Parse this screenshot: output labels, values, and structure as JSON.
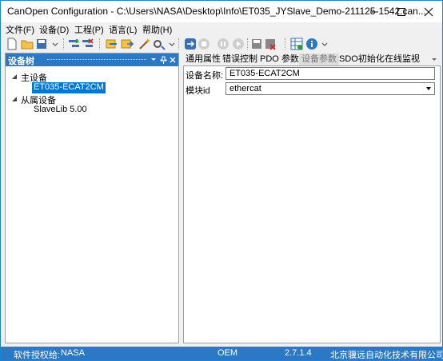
{
  "window": {
    "title": "CanOpen Configuration - C:\\Users\\NASA\\Desktop\\Info\\ET035_JYSlave_Demo-211125-1542.can...",
    "controls": [
      "minimize-icon",
      "maximize-icon",
      "close-icon"
    ]
  },
  "menu": {
    "items": [
      {
        "label": "文件(F)"
      },
      {
        "label": "设备(D)"
      },
      {
        "label": "工程(P)"
      },
      {
        "label": "语言(L)"
      },
      {
        "label": "帮助(H)"
      }
    ]
  },
  "toolbar": {
    "icons": [
      "new-file-icon",
      "open-folder-icon",
      "save-icon",
      "add-device-icon",
      "remove-device-icon",
      "import-icon",
      "export-icon",
      "wand-icon",
      "settings-icon",
      "connect-icon",
      "stop-icon",
      "pause-icon",
      "play-icon",
      "save-config-icon",
      "delete-config-icon",
      "grid-icon",
      "info-icon"
    ]
  },
  "device_tree": {
    "title": "设备树",
    "master_label": "主设备",
    "master_child": "ET035-ECAT2CM",
    "slave_label": "从属设备",
    "slave_child": "SlaveLib 5.00"
  },
  "tabs": [
    {
      "label": "通用属性",
      "active": false
    },
    {
      "label": "错误控制",
      "active": false
    },
    {
      "label": "PDO 参数",
      "active": false
    },
    {
      "label": "设备参数",
      "active": true
    },
    {
      "label": "SDO初始化",
      "active": false
    },
    {
      "label": "在线监视",
      "active": false
    }
  ],
  "form": {
    "device_name_label": "设备名称:",
    "device_name_value": "ET035-ECAT2CM",
    "module_id_label": "模块id",
    "module_id_value": "ethercat"
  },
  "status": {
    "license_label": "软件授权给:",
    "license_user": "NASA",
    "edition": "OEM",
    "version": "2.7.1.4",
    "company": "北京骥远自动化技术有限公司"
  },
  "colors": {
    "accent": "#2b78c5",
    "selection": "#0078d7",
    "window_border": "#1883d7"
  }
}
